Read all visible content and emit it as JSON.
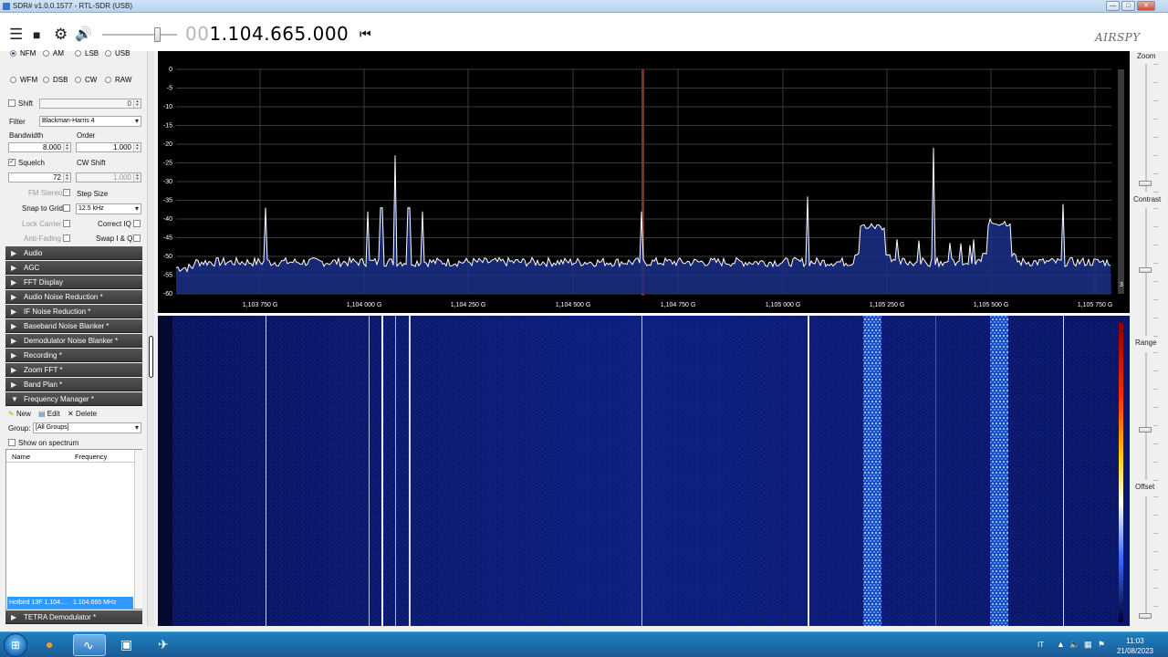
{
  "window": {
    "title": "SDR# v1.0.0.1577 - RTL-SDR (USB)",
    "buttons": [
      "—",
      "□",
      "✕"
    ]
  },
  "toolbar": {
    "frequency_dim": "00",
    "frequency": "1.104.665.000",
    "logo": "AIRSPY"
  },
  "radio": {
    "modes": [
      "NFM",
      "AM",
      "LSB",
      "USB",
      "WFM",
      "DSB",
      "CW",
      "RAW"
    ],
    "selected": "NFM"
  },
  "controls": {
    "shift_label": "Shift",
    "shift_value": "0",
    "filter_label": "Filter",
    "filter_value": "Blackman-Harris 4",
    "bandwidth_label": "Bandwidth",
    "bandwidth_value": "8.000",
    "order_label": "Order",
    "order_value": "1.000",
    "squelch_label": "Squelch",
    "squelch_value": "72",
    "cw_shift_label": "CW Shift",
    "cw_shift_value": "1.000",
    "fm_stereo_label": "FM Stereo",
    "step_size_label": "Step Size",
    "snap_to_grid_label": "Snap to Grid",
    "step_size_value": "12.5 kHz",
    "lock_carrier_label": "Lock Carrier",
    "correct_iq_label": "Correct IQ",
    "anti_fading_label": "Anti-Fading",
    "swap_iq_label": "Swap I & Q"
  },
  "sections": [
    "Audio",
    "AGC",
    "FFT Display",
    "Audio Noise Reduction *",
    "IF Noise Reduction *",
    "Baseband Noise Blanker *",
    "Demodulator Noise Blanker *",
    "Recording *",
    "Zoom FFT *",
    "Band Plan *",
    "Frequency Manager *"
  ],
  "freq_manager": {
    "new_label": "New",
    "edit_label": "Edit",
    "delete_label": "Delete",
    "group_label": "Group:",
    "group_value": "[All Groups]",
    "show_on_spectrum_label": "Show on spectrum",
    "col_name": "Name",
    "col_frequency": "Frequency",
    "selected_row": {
      "name": "Hotbird 13F 1.104....",
      "frequency": "1.104.665 MHz"
    }
  },
  "tetra_section": "TETRA Demodulator *",
  "spectrum": {
    "y_ticks": [
      "0",
      "-5",
      "-10",
      "-15",
      "-20",
      "-25",
      "-30",
      "-35",
      "-40",
      "-45",
      "-50",
      "-55",
      "-60"
    ],
    "x_ticks": [
      "1,103 750 G",
      "1,104 000 G",
      "1,104 250 G",
      "1,104 500 G",
      "1,104 750 G",
      "1,105 000 G",
      "1,105 250 G",
      "1,105 500 G",
      "1,105 750 G"
    ],
    "scroll_value": "3"
  },
  "right_panel": {
    "zoom_label": "Zoom",
    "contrast_label": "Contrast",
    "range_label": "Range",
    "offset_label": "Offset"
  },
  "taskbar": {
    "language": "IT",
    "time": "11:03",
    "date": "21/08/2023"
  }
}
